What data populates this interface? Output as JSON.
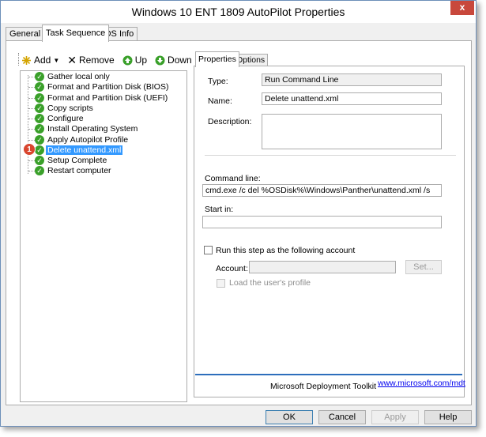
{
  "window": {
    "title": "Windows 10 ENT 1809 AutoPilot Properties",
    "close_glyph": "x"
  },
  "top_tabs": [
    {
      "label": "General"
    },
    {
      "label": "Task Sequence"
    },
    {
      "label": "OS Info"
    }
  ],
  "toolbar": {
    "add": "Add",
    "remove": "Remove",
    "up": "Up",
    "down": "Down"
  },
  "tree": {
    "items": [
      {
        "label": "Gather local only"
      },
      {
        "label": "Format and Partition Disk (BIOS)"
      },
      {
        "label": "Format and Partition Disk (UEFI)"
      },
      {
        "label": "Copy scripts"
      },
      {
        "label": "Configure"
      },
      {
        "label": "Install Operating System"
      },
      {
        "label": "Apply Autopilot Profile"
      },
      {
        "label": "Delete unattend.xml"
      },
      {
        "label": "Setup Complete"
      },
      {
        "label": "Restart computer"
      }
    ],
    "selected_index": 7,
    "callout_number": "1"
  },
  "inner_tabs": [
    {
      "label": "Properties"
    },
    {
      "label": "Options"
    }
  ],
  "properties": {
    "type_label": "Type:",
    "type_value": "Run Command Line",
    "name_label": "Name:",
    "name_value": "Delete unattend.xml",
    "description_label": "Description:",
    "description_value": "",
    "command_line_label": "Command line:",
    "command_line_value": "cmd.exe /c del %OSDisk%\\Windows\\Panther\\unattend.xml /s",
    "start_in_label": "Start in:",
    "start_in_value": "",
    "run_as_label": "Run this step as the following account",
    "account_label": "Account:",
    "account_value": "",
    "set_button": "Set...",
    "load_profile_label": "Load the user's profile",
    "footer_brand": "Microsoft Deployment Toolkit",
    "footer_link": "www.microsoft.com/mdt"
  },
  "buttons": {
    "ok": "OK",
    "cancel": "Cancel",
    "apply": "Apply",
    "help": "Help"
  },
  "colors": {
    "selection": "#3399ff",
    "check_green": "#3aa02a",
    "callout_red": "#d9462f",
    "accent_line": "#2d6ebc"
  }
}
